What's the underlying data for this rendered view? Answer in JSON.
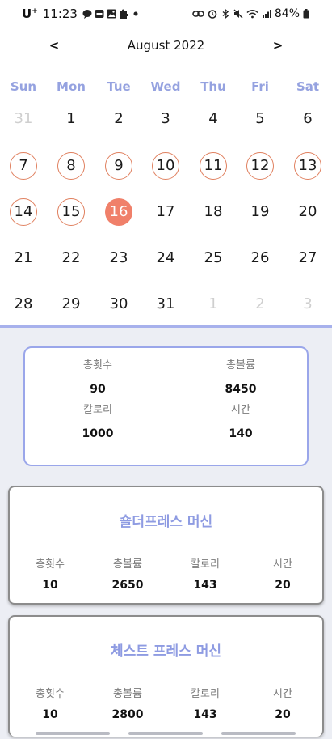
{
  "status_bar": {
    "carrier": "U",
    "carrier_sup": "+",
    "time": "11:23",
    "battery": "84%",
    "left_icons": [
      "chat-icon",
      "talk-badge-icon",
      "gallery-icon",
      "puzzle-icon",
      "dot-icon"
    ],
    "right_icons": [
      "link-icon",
      "alarm-icon",
      "bluetooth-icon",
      "mute-icon",
      "wifi-icon",
      "signal-icon",
      "battery-icon"
    ]
  },
  "calendar": {
    "title": "August 2022",
    "prev_label": "<",
    "next_label": ">",
    "weekdays": [
      "Sun",
      "Mon",
      "Tue",
      "Wed",
      "Thu",
      "Fri",
      "Sat"
    ],
    "weeks": [
      [
        {
          "d": "31",
          "muted": true
        },
        {
          "d": "1"
        },
        {
          "d": "2"
        },
        {
          "d": "3"
        },
        {
          "d": "4"
        },
        {
          "d": "5"
        },
        {
          "d": "6"
        }
      ],
      [
        {
          "d": "7",
          "ringed": true
        },
        {
          "d": "8",
          "ringed": true
        },
        {
          "d": "9",
          "ringed": true
        },
        {
          "d": "10",
          "ringed": true
        },
        {
          "d": "11",
          "ringed": true
        },
        {
          "d": "12",
          "ringed": true
        },
        {
          "d": "13",
          "ringed": true
        }
      ],
      [
        {
          "d": "14",
          "ringed": true
        },
        {
          "d": "15",
          "ringed": true
        },
        {
          "d": "16",
          "today": true
        },
        {
          "d": "17"
        },
        {
          "d": "18"
        },
        {
          "d": "19"
        },
        {
          "d": "20"
        }
      ],
      [
        {
          "d": "21"
        },
        {
          "d": "22"
        },
        {
          "d": "23"
        },
        {
          "d": "24"
        },
        {
          "d": "25"
        },
        {
          "d": "26"
        },
        {
          "d": "27"
        }
      ],
      [
        {
          "d": "28"
        },
        {
          "d": "29"
        },
        {
          "d": "30"
        },
        {
          "d": "31"
        },
        {
          "d": "1",
          "muted": true
        },
        {
          "d": "2",
          "muted": true
        },
        {
          "d": "3",
          "muted": true
        }
      ]
    ]
  },
  "summary": {
    "reps_label": "총횟수",
    "reps_value": "90",
    "volume_label": "총볼륨",
    "volume_value": "8450",
    "calories_label": "칼로리",
    "calories_value": "1000",
    "time_label": "시간",
    "time_value": "140"
  },
  "machines": [
    {
      "title": "숄더프레스 머신",
      "stats": [
        {
          "label": "총횟수",
          "value": "10"
        },
        {
          "label": "총볼륨",
          "value": "2650"
        },
        {
          "label": "칼로리",
          "value": "143"
        },
        {
          "label": "시간",
          "value": "20"
        }
      ]
    },
    {
      "title": "체스트 프레스 머신",
      "stats": [
        {
          "label": "총횟수",
          "value": "10"
        },
        {
          "label": "총볼륨",
          "value": "2800"
        },
        {
          "label": "칼로리",
          "value": "143"
        },
        {
          "label": "시간",
          "value": "20"
        }
      ]
    }
  ],
  "colors": {
    "accent": "#95a2e0",
    "ring": "#e0805f",
    "today": "#f0806a",
    "background": "#eceef4"
  }
}
